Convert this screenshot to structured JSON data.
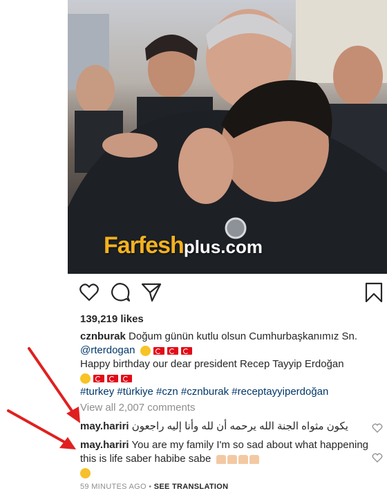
{
  "post": {
    "likes": "139,219 likes",
    "watermark_main": "Farfesh",
    "watermark_plus": "plus.com"
  },
  "caption": {
    "username": "cznburak",
    "text_line1": "Doğum günün kutlu olsun Cumhurbaşkanımız Sn.",
    "mention": "@rterdogan",
    "text_line2": "Happy birthday our dear president Recep Tayyip Erdoğan",
    "hashtags": "#turkey #türkiye #czn #cznburak #receptayyiperdoğan"
  },
  "view_comments": "View all 2,007 comments",
  "comments": [
    {
      "username": "may.hariri",
      "text": "يكون مثواه الجنة الله يرحمه أن لله وأنا إليه راجعون"
    },
    {
      "username": "may.hariri",
      "text": "You are my family I'm so sad about what happening  this is life saber habibe sabe"
    }
  ],
  "meta": {
    "time": "59 MINUTES AGO",
    "separator": "•",
    "translation": "SEE TRANSLATION"
  },
  "icons": [
    "heart-icon",
    "comment-icon",
    "share-icon",
    "bookmark-icon",
    "small-heart-icon",
    "turkish-flag-icon",
    "smile-emoji",
    "pray-emoji",
    "sad-emoji",
    "red-arrow"
  ],
  "colors": {
    "link": "#00376b",
    "muted": "#8e8e8e",
    "text": "#262626",
    "watermark": "#f4b11f",
    "arrow": "#e02020"
  }
}
